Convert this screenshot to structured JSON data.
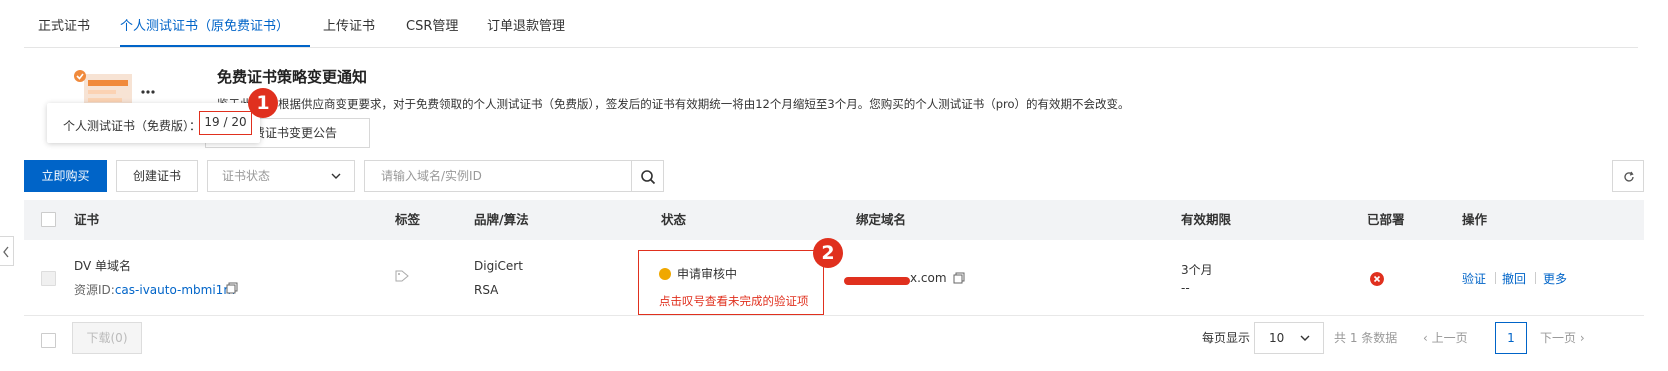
{
  "tabs": {
    "items": [
      {
        "label": "正式证书"
      },
      {
        "label": "个人测试证书（原免费证书）"
      },
      {
        "label": "上传证书"
      },
      {
        "label": "CSR管理"
      },
      {
        "label": "订单退款管理"
      }
    ]
  },
  "notice": {
    "title": "免费证书策略变更通知",
    "prefix": "鉴于此",
    "text": "根据供应商变更要求，对于免费领取的个人测试证书（免费版），签发后的证书有效期统一将由12个月缩短至3个月。您购买的个人测试证书（pro）的有效期不会改变。",
    "link_label": "免费证书变更公告"
  },
  "quota": {
    "label": "个人测试证书（免费版）：",
    "value": "19 / 20"
  },
  "annotations": {
    "badge1": "1",
    "badge2": "2"
  },
  "toolbar": {
    "buy_label": "立即购买",
    "create_label": "创建证书",
    "status_placeholder": "证书状态",
    "search_placeholder": "请输入域名/实例ID"
  },
  "table": {
    "columns": [
      "证书",
      "标签",
      "品牌/算法",
      "状态",
      "绑定域名",
      "有效期限",
      "已部署",
      "操作"
    ],
    "rows": [
      {
        "cert_name": "DV 单域名",
        "resource_prefix": "资源ID:",
        "resource_id": "cas-ivauto-mbmi1m",
        "brand": "DigiCert",
        "algorithm": "RSA",
        "status": "申请审核中",
        "status_hint": "点击叹号查看未完成的验证项",
        "domain_suffix": "x.com",
        "validity": "3个月",
        "validity_sub": "--",
        "deployed": "error",
        "actions": [
          "验证",
          "撤回",
          "更多"
        ]
      }
    ]
  },
  "footer": {
    "download_label": "下载(0)",
    "page_size_label": "每页显示",
    "page_size": "10",
    "total": "共 1 条数据",
    "prev": "上一页",
    "current_page": "1",
    "next": "下一页"
  },
  "colors": {
    "primary": "#0064c8",
    "error": "#e0301e",
    "warning": "#f0a800"
  }
}
